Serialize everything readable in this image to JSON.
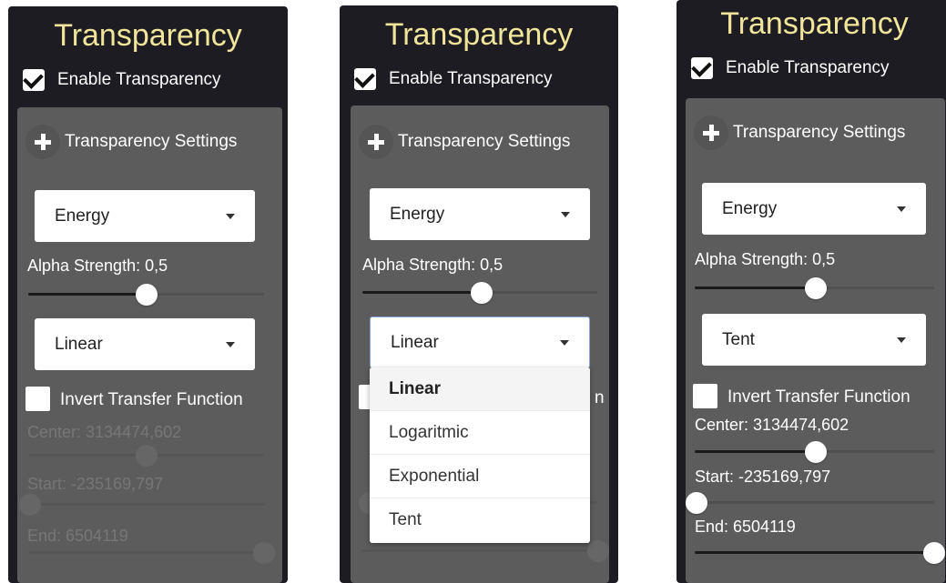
{
  "panels": [
    {
      "title": "Transparency",
      "enable_label": "Enable Transparency",
      "enable_checked": true,
      "settings_label": "Transparency Settings",
      "mode_select": "Energy",
      "alpha_label": "Alpha Strength: 0,5",
      "alpha_value": 0.5,
      "function_select": "Linear",
      "invert_label": "Invert Transfer Function",
      "invert_checked": false,
      "center_label": "Center: 3134474,602",
      "start_label": "Start: -235169,797",
      "end_label": "End: 6504119"
    },
    {
      "title": "Transparency",
      "enable_label": "Enable Transparency",
      "enable_checked": true,
      "settings_label": "Transparency Settings",
      "mode_select": "Energy",
      "alpha_label": "Alpha Strength: 0,5",
      "alpha_value": 0.5,
      "function_select": "Linear",
      "invert_label_visible": "n",
      "dropdown_open": true,
      "dropdown_options": [
        "Linear",
        "Logaritmic",
        "Exponential",
        "Tent"
      ],
      "dropdown_selected": "Linear"
    },
    {
      "title": "Transparency",
      "enable_label": "Enable Transparency",
      "enable_checked": true,
      "settings_label": "Transparency Settings",
      "mode_select": "Energy",
      "alpha_label": "Alpha Strength: 0,5",
      "alpha_value": 0.5,
      "function_select": "Tent",
      "invert_label": "Invert Transfer Function",
      "invert_checked": false,
      "center_label": "Center: 3134474,602",
      "start_label": "Start: -235169,797",
      "end_label": "End: 6504119"
    }
  ],
  "colors": {
    "title": "#f0e59a",
    "panel_bg": "#1c1c22",
    "card_bg": "#5c5c5c",
    "text": "#ffffff"
  }
}
